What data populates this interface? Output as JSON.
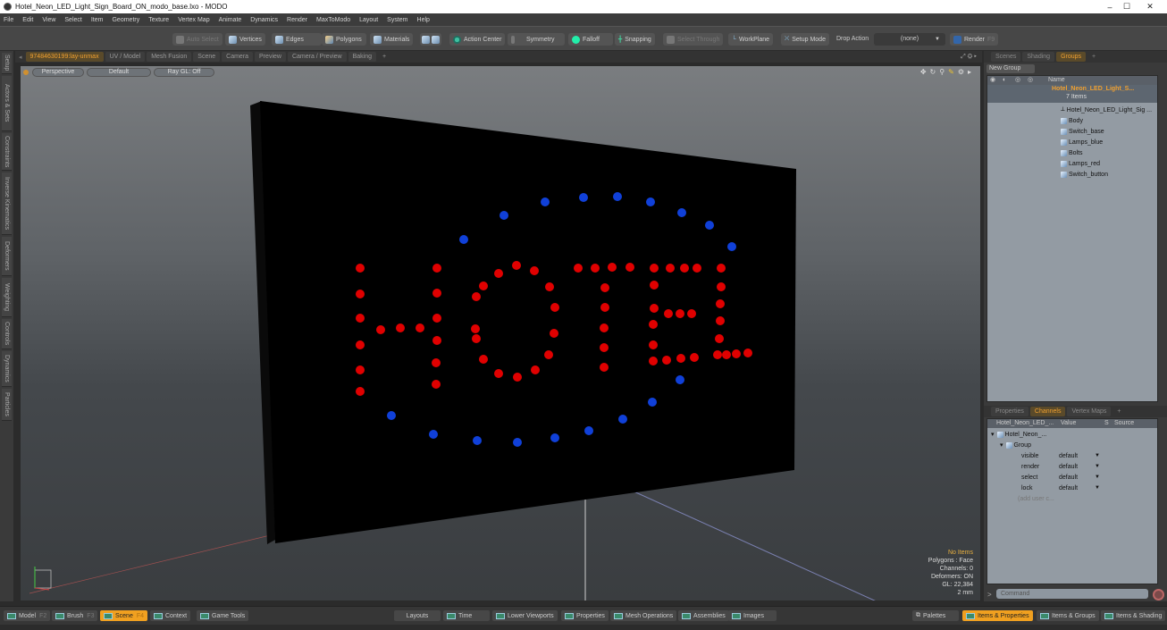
{
  "window": {
    "title": "Hotel_Neon_LED_Light_Sign_Board_ON_modo_base.lxo - MODO",
    "controls": [
      "minimize",
      "maximize",
      "close"
    ]
  },
  "menu": [
    "File",
    "Edit",
    "View",
    "Select",
    "Item",
    "Geometry",
    "Texture",
    "Vertex Map",
    "Animate",
    "Dynamics",
    "Render",
    "MaxToModo",
    "Layout",
    "System",
    "Help"
  ],
  "toolbar": {
    "auto_select": "Auto Select",
    "vertices": "Vertices",
    "edges": "Edges",
    "polygons": "Polygons",
    "materials": "Materials",
    "action_center": "Action Center",
    "symmetry": "Symmetry",
    "falloff": "Falloff",
    "snapping": "Snapping",
    "select_through": "Select Through",
    "workplane": "WorkPlane",
    "setup_mode": "Setup Mode",
    "drop_action_label": "Drop Action",
    "drop_action_value": "(none)",
    "render": "Render",
    "render_key": "F9"
  },
  "left_tabs": [
    "Setup",
    "Actors & Sets",
    "Constraints",
    "Inverse Kinematics",
    "Deformers",
    "Weighting",
    "Controls",
    "Dynamics",
    "Particles"
  ],
  "view_tabs": [
    "97484630199:lay-unmax",
    "UV / Model",
    "Mesh Fusion",
    "Scene",
    "Camera",
    "Preview",
    "Camera / Preview",
    "Baking",
    "+"
  ],
  "viewport": {
    "projection": "Perspective",
    "shading": "Default",
    "raygl": "Ray GL: Off",
    "hud": {
      "selection": "No Items",
      "polygons": "Polygons : Face",
      "channels": "Channels: 0",
      "deformers": "Deformers: ON",
      "gl": "GL: 22,384",
      "unit": "2 mm"
    },
    "colors": {
      "sign": "#000000",
      "led_red": "#e00000",
      "led_blue": "#1040d8"
    }
  },
  "groups_panel": {
    "tabs": [
      "Scenes",
      "Shading",
      "Groups",
      "+"
    ],
    "active_tab": "Groups",
    "new_group": "New Group",
    "name_header": "Name",
    "root": "Hotel_Neon_LED_Light_S...",
    "count": "7 Items",
    "items": [
      "Hotel_Neon_LED_Light_Sig ...",
      "Body",
      "Switch_base",
      "Lamps_blue",
      "Bolts",
      "Lamps_red",
      "Switch_button"
    ]
  },
  "channels_panel": {
    "tabs": [
      "Properties",
      "Channels",
      "Vertex Maps",
      "+"
    ],
    "active_tab": "Channels",
    "headers": [
      "Hotel_Neon_LED_...",
      "Value",
      "S",
      "Source"
    ],
    "root": "Hotel_Neon_...",
    "group": "Group",
    "rows": [
      {
        "name": "visible",
        "value": "default"
      },
      {
        "name": "render",
        "value": "default"
      },
      {
        "name": "select",
        "value": "default"
      },
      {
        "name": "lock",
        "value": "default"
      }
    ],
    "add_user": "(add user c..."
  },
  "command": {
    "prompt": ">",
    "placeholder": "Command"
  },
  "statusbar": {
    "left": [
      {
        "label": "Model",
        "key": "F2"
      },
      {
        "label": "Brush",
        "key": "F3"
      },
      {
        "label": "Scene",
        "key": "F4",
        "active": true
      },
      {
        "label": "Context",
        "key": ""
      },
      {
        "label": "Game Tools",
        "key": ""
      }
    ],
    "middle": [
      "Layouts",
      "Time",
      "Lower Viewports",
      "Properties",
      "Mesh Operations",
      "Assemblies",
      "Images"
    ],
    "right": [
      {
        "label": "Palettes"
      },
      {
        "label": "Items & Properties",
        "active": true
      },
      {
        "label": "Items & Groups"
      },
      {
        "label": "Items & Shading"
      }
    ]
  }
}
